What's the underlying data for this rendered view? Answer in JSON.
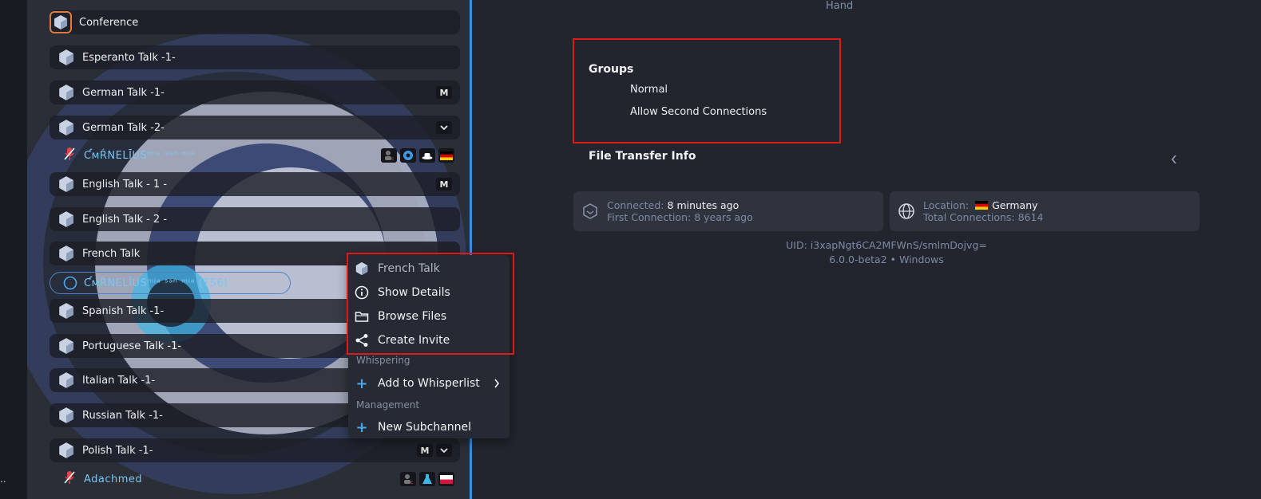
{
  "strip": {
    "dots": ".."
  },
  "channels": [
    {
      "label": "Conference",
      "badge": ""
    },
    {
      "label": "Esperanto Talk -1-",
      "badge": ""
    },
    {
      "label": "German Talk -1-",
      "badge": "M"
    },
    {
      "label": "German Talk -2-",
      "badge": ""
    },
    {
      "label": "English Talk - 1 -",
      "badge": "M"
    },
    {
      "label": "English Talk - 2 -",
      "badge": ""
    },
    {
      "label": "French Talk",
      "badge": ""
    },
    {
      "label": "Spanish Talk -1-",
      "badge": ""
    },
    {
      "label": "Portuguese Talk -1-",
      "badge": ""
    },
    {
      "label": "Italian Talk -1-",
      "badge": ""
    },
    {
      "label": "Russian Talk -1-",
      "badge": ""
    },
    {
      "label": "Polish Talk -1-",
      "badge": "M"
    }
  ],
  "users": {
    "cornelius": "ƇᴍŔNELĪUSᵐⁱᵃ ˢᵃⁿ ᵐⁱᵃ",
    "cornelius_ts6": "ƇᴍŔNELĪUSᵐⁱᵃ ˢᵃⁿ ᵐⁱᵃ (TS6)",
    "adachmed": "Adachmed"
  },
  "context_menu": {
    "title": "French Talk",
    "show_details": "Show Details",
    "browse_files": "Browse Files",
    "create_invite": "Create Invite",
    "section_whispering": "Whispering",
    "add_whisperlist": "Add to Whisperlist",
    "section_management": "Management",
    "new_subchannel": "New Subchannel"
  },
  "details": {
    "hand": "Hand",
    "groups_title": "Groups",
    "groups": [
      "Normal",
      "Allow Second Connections"
    ],
    "file_transfer_title": "File Transfer Info",
    "connected_label": "Connected:",
    "connected_value": "8 minutes ago",
    "first_connection": "First Connection: 8 years ago",
    "location_label": "Location:",
    "location_value": "Germany",
    "total_connections": "Total Connections: 8614",
    "uid": "UID: i3xapNgt6CA2MFWnS/smlmDojvg=",
    "version": "6.0.0-beta2 • Windows"
  },
  "colors": {
    "accent_blue": "#3b8fe0",
    "highlight_red": "#e01818",
    "user_blue": "#7cc4f5"
  }
}
